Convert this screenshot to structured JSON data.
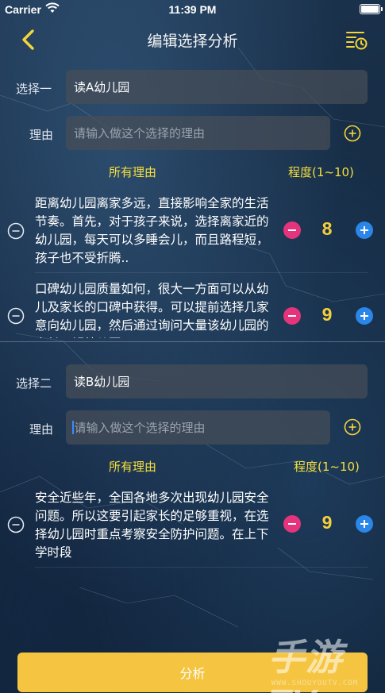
{
  "status_bar": {
    "carrier": "Carrier",
    "time": "11:39 PM"
  },
  "nav": {
    "title": "编辑选择分析"
  },
  "choices": [
    {
      "label": "选择一",
      "value": "读A幼儿园",
      "reason_label": "理由",
      "reason_placeholder": "请输入做这个选择的理由",
      "all_reasons_title": "所有理由",
      "degree_title": "程度(1~10)",
      "reasons": [
        {
          "text": "距离幼儿园离家多远，直接影响全家的生活节奏。首先，对于孩子来说，选择离家近的幼儿园，每天可以多睡会儿，而且路程短，孩子也不受折腾..",
          "degree": "8"
        },
        {
          "text": "口碑幼儿园质量如何，很大一方面可以从幼儿及家长的口碑中获得。可以提前选择几家意向幼儿园，然后通过询问大量该幼儿园的家长了解幼儿园",
          "degree": "9"
        }
      ]
    },
    {
      "label": "选择二",
      "value": "读B幼儿园",
      "reason_label": "理由",
      "reason_placeholder": "请输入做这个选择的理由",
      "all_reasons_title": "所有理由",
      "degree_title": "程度(1~10)",
      "reasons": [
        {
          "text": "安全近些年，全国各地多次出现幼儿园安全问题。所以这要引起家长的足够重视，在选择幼儿园时重点考察安全防护问题。在上下学时段",
          "degree": "9"
        }
      ]
    }
  ],
  "analyze_button": "分析",
  "watermark": {
    "text": "手游TV",
    "url": "WWW.SHOUYOUTV.COM"
  },
  "colors": {
    "accent": "#f5c542",
    "minus": "#e5347c",
    "plus": "#2a86e8",
    "degree": "#f6cf3c"
  }
}
